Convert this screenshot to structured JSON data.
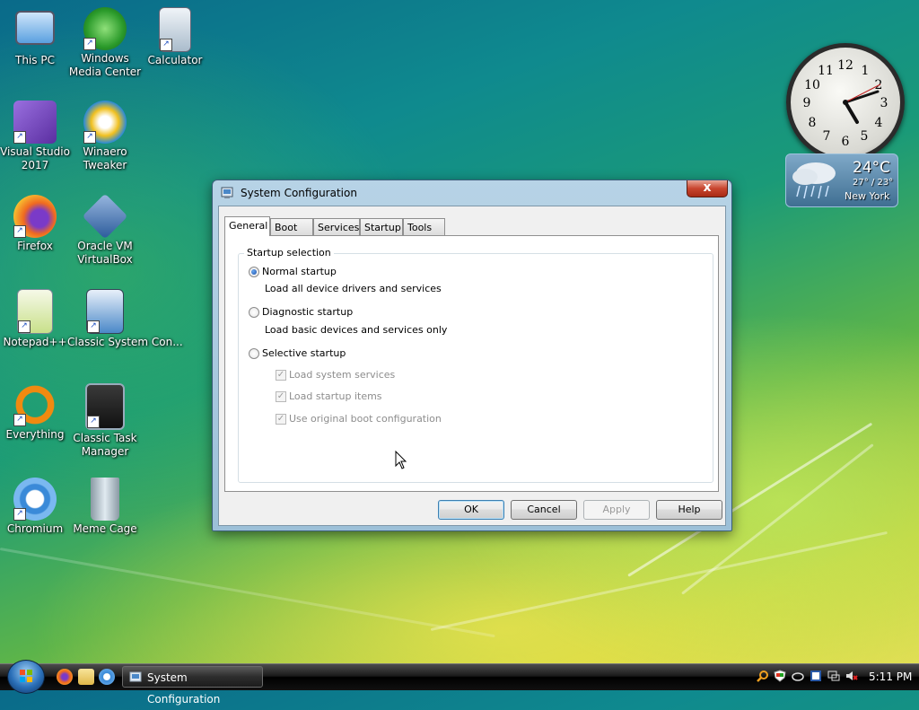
{
  "desktop": {
    "icons": [
      {
        "label": "This PC",
        "icon": "computer-icon",
        "color": "#5aa0e0"
      },
      {
        "label": "Windows Media Center",
        "icon": "windows-media-center-icon",
        "color": "#3aa838"
      },
      {
        "label": "Calculator",
        "icon": "calculator-icon",
        "color": "#c8d8e8"
      },
      {
        "label": "Visual Studio 2017",
        "icon": "visual-studio-icon",
        "color": "#7a4ec0"
      },
      {
        "label": "Winaero Tweaker",
        "icon": "winaero-tweaker-icon",
        "color": "#f0c020"
      },
      {
        "label": "Firefox",
        "icon": "firefox-icon",
        "color": "#f06a20"
      },
      {
        "label": "Oracle VM VirtualBox",
        "icon": "virtualbox-icon",
        "color": "#2a5a9a"
      },
      {
        "label": "Notepad++",
        "icon": "notepad-plus-plus-icon",
        "color": "#8cc43c"
      },
      {
        "label": "Classic System Con...",
        "icon": "system-configuration-icon",
        "color": "#4a88c8"
      },
      {
        "label": "Everything",
        "icon": "everything-search-icon",
        "color": "#f08a10"
      },
      {
        "label": "Classic Task Manager",
        "icon": "task-manager-icon",
        "color": "#2a2a2a"
      },
      {
        "label": "Chromium",
        "icon": "chromium-icon",
        "color": "#3a8ad8"
      },
      {
        "label": "Meme Cage",
        "icon": "recycle-bin-icon",
        "color": "#a8b8c0"
      }
    ]
  },
  "gadgets": {
    "clock": {
      "numerals": [
        "12",
        "1",
        "2",
        "3",
        "4",
        "5",
        "6",
        "7",
        "8",
        "9",
        "10",
        "11"
      ]
    },
    "weather": {
      "temp": "24°C",
      "range": "27° / 23°",
      "city": "New York"
    }
  },
  "dialog": {
    "title": "System Configuration",
    "close_label": "x",
    "tabs": [
      "General",
      "Boot",
      "Services",
      "Startup",
      "Tools"
    ],
    "active_tab": "General",
    "group_label": "Startup selection",
    "options": [
      {
        "label": "Normal startup",
        "description": "Load all device drivers and services",
        "selected": true
      },
      {
        "label": "Diagnostic startup",
        "description": "Load basic devices and services only",
        "selected": false
      },
      {
        "label": "Selective startup",
        "description": "",
        "selected": false
      }
    ],
    "sub_options": [
      {
        "label": "Load system services",
        "checked": true,
        "enabled": false
      },
      {
        "label": "Load startup items",
        "checked": true,
        "enabled": false
      },
      {
        "label": "Use original boot configuration",
        "checked": true,
        "enabled": false
      }
    ],
    "buttons": {
      "ok": "OK",
      "cancel": "Cancel",
      "apply": "Apply",
      "help": "Help"
    }
  },
  "taskbar": {
    "task_button": "System Configuration",
    "time": "5:11 PM",
    "quick_launch": [
      "firefox-icon",
      "folder-icon",
      "chromium-icon"
    ],
    "tray": [
      "search-icon",
      "shield-icon",
      "cloud-icon",
      "flag-icon",
      "network-icon",
      "volume-muted-icon"
    ]
  },
  "colors": {
    "accent": "#3c7fb1",
    "close": "#c8452e"
  }
}
